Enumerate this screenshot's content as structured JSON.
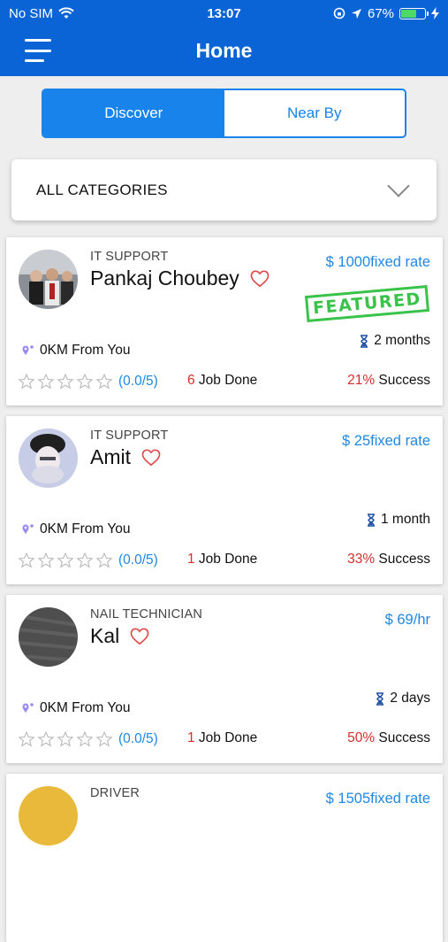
{
  "status": {
    "carrier": "No SIM",
    "time": "13:07",
    "battery": "67%",
    "battery_level": 0.67
  },
  "nav": {
    "title": "Home"
  },
  "tabs": [
    {
      "label": "Discover",
      "active": true
    },
    {
      "label": "Near By",
      "active": false
    }
  ],
  "filter": {
    "label": "ALL CATEGORIES"
  },
  "colors": {
    "primary": "#0a64d6",
    "accent": "#1883ea",
    "featured": "#39c34a",
    "highlight": "#d62d2d"
  },
  "cards": [
    {
      "category": "IT SUPPORT",
      "name": "Pankaj Choubey",
      "rate": "$ 1000fixed rate",
      "featured": "FEATURED",
      "distance": "0KM From You",
      "duration": "2 months",
      "rating": "(0.0/5)",
      "jobs_count": "6",
      "jobs_label": " Job Done",
      "success_pct": "21%",
      "success_label": " Success"
    },
    {
      "category": "IT SUPPORT",
      "name": "Amit",
      "rate": "$ 25fixed rate",
      "distance": "0KM From You",
      "duration": "1 month",
      "rating": "(0.0/5)",
      "jobs_count": "1",
      "jobs_label": " Job Done",
      "success_pct": "33%",
      "success_label": " Success"
    },
    {
      "category": "NAIL TECHNICIAN",
      "name": "Kal",
      "rate": "$ 69/hr",
      "distance": "0KM From You",
      "duration": "2 days",
      "rating": "(0.0/5)",
      "jobs_count": "1",
      "jobs_label": " Job Done",
      "success_pct": "50%",
      "success_label": " Success"
    },
    {
      "category": "DRIVER",
      "rate": "$ 1505fixed rate"
    }
  ]
}
